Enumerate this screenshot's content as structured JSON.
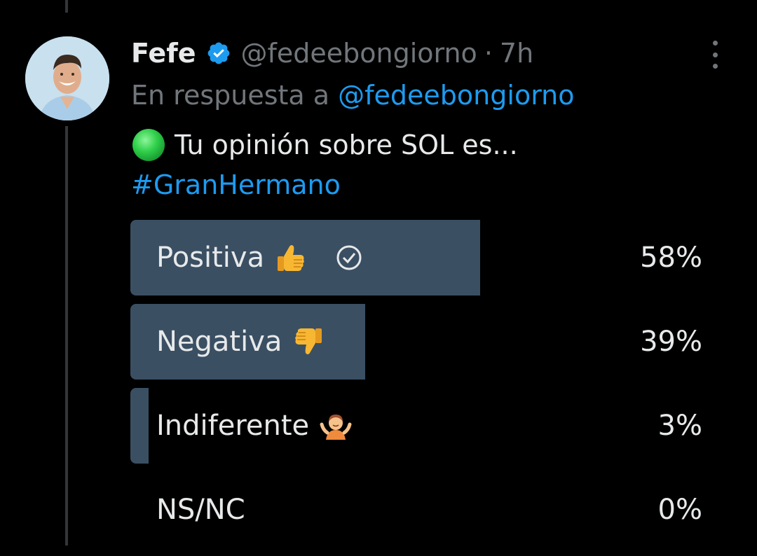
{
  "tweet": {
    "author_name": "Fefe",
    "handle": "@fedeebongiorno",
    "separator": "·",
    "time": "7h",
    "reply_prefix": "En respuesta a",
    "reply_to": "@fedeebongiorno",
    "text": "Tu opinión sobre SOL es...",
    "hashtag": "#GranHermano",
    "text_emoji": "green-circle-icon"
  },
  "poll": {
    "options": [
      {
        "label": "Positiva",
        "emoji": "thumbs-up-icon",
        "percent_text": "58%",
        "fraction": 0.58,
        "winner": true
      },
      {
        "label": "Negativa",
        "emoji": "thumbs-down-icon",
        "percent_text": "39%",
        "fraction": 0.39,
        "winner": false
      },
      {
        "label": "Indiferente",
        "emoji": "person-shrugging-icon",
        "percent_text": "3%",
        "fraction": 0.03,
        "winner": false
      },
      {
        "label": "NS/NC",
        "emoji": "",
        "percent_text": "0%",
        "fraction": 0.0,
        "winner": false
      }
    ]
  },
  "colors": {
    "background": "#000000",
    "text": "#e7e9ea",
    "muted": "#71767b",
    "link": "#1d9bf0",
    "bar": "#3b4f63"
  }
}
